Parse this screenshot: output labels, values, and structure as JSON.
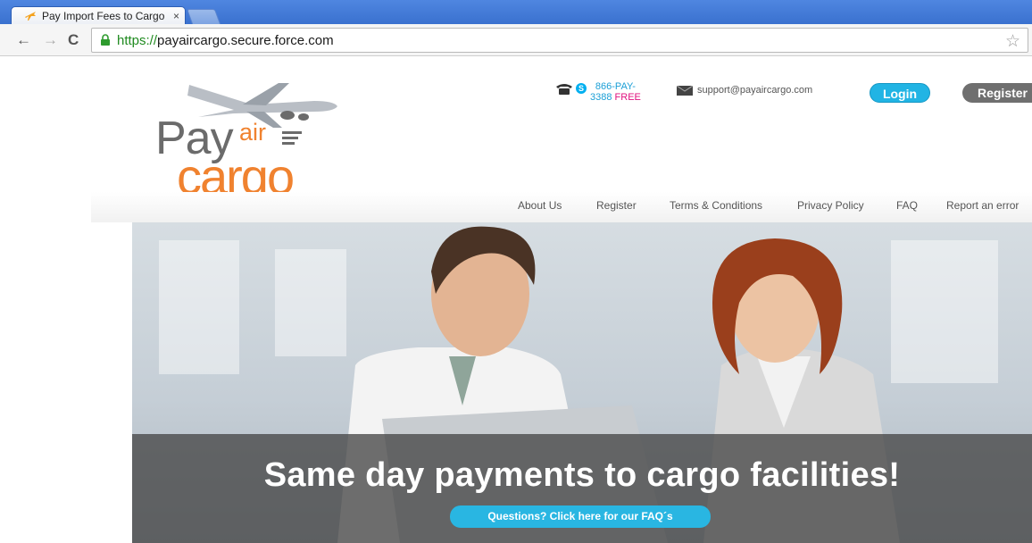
{
  "browser": {
    "tab_title": "Pay Import Fees to Cargo",
    "tab_close": "×",
    "url_scheme": "https://",
    "url_host": "payaircargo.secure.force.com",
    "star": "☆"
  },
  "logo": {
    "pay": "Pay",
    "air": "air",
    "cargo": "cargo"
  },
  "contact": {
    "phone_line1": "866-PAY-",
    "phone_line2": "3388",
    "phone_free": "FREE",
    "email": "support@payaircargo.com"
  },
  "auth": {
    "login": "Login",
    "register": "Register"
  },
  "nav": {
    "items": [
      {
        "label": "About Us"
      },
      {
        "label": "Register"
      },
      {
        "label": "Terms & Conditions"
      },
      {
        "label": "Privacy Policy"
      },
      {
        "label": "FAQ"
      },
      {
        "label": "Report an error"
      }
    ]
  },
  "hero": {
    "heading": "Same day payments to cargo facilities!",
    "cta": "Questions? Click here for our FAQ´s"
  },
  "colors": {
    "accent_blue": "#21b4e4",
    "logo_orange": "#f0822f",
    "chrome_blue": "#3a71cf"
  }
}
